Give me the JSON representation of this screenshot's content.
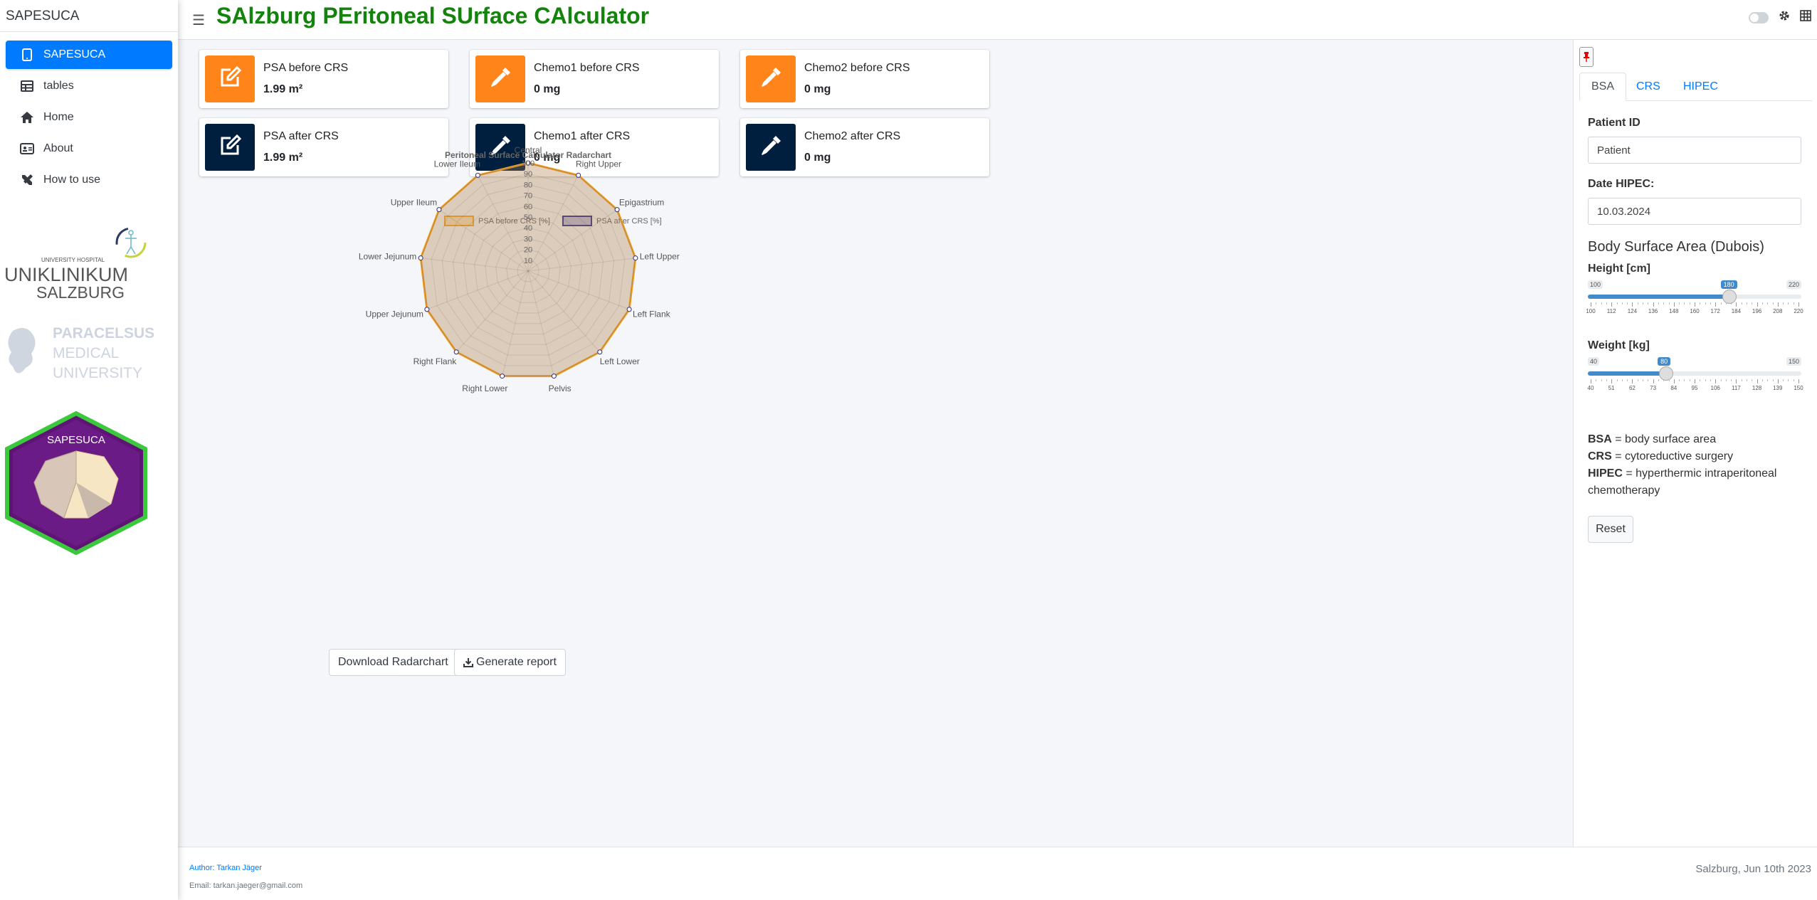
{
  "sidebar": {
    "brand": "SAPESUCA",
    "items": [
      {
        "label": "SAPESUCA",
        "icon": "tablet-icon"
      },
      {
        "label": "tables",
        "icon": "table-icon"
      },
      {
        "label": "Home",
        "icon": "home-icon"
      },
      {
        "label": "About",
        "icon": "id-card-icon"
      },
      {
        "label": "How to use",
        "icon": "tools-icon"
      }
    ],
    "logo_uk": {
      "small": "UNIVERSITY HOSPITAL",
      "line1": "UNIKLINIKUM",
      "line2": "SALZBURG"
    },
    "logo_pmu": {
      "line1": "PARACELSUS",
      "line2": "MEDICAL",
      "line3": "UNIVERSITY"
    },
    "hex_label": "SAPESUCA"
  },
  "header": {
    "title": "SAlzburg PEritoneal SUrface CAlculator",
    "title_color": "#14830d"
  },
  "infoboxes": [
    {
      "label": "PSA before CRS",
      "value": "1.99 m²",
      "icon": "edit-icon",
      "color": "#ff851b"
    },
    {
      "label": "Chemo1 before CRS",
      "value": "0 mg",
      "icon": "eyedropper-icon",
      "color": "#ff851b"
    },
    {
      "label": "Chemo2 before CRS",
      "value": "0 mg",
      "icon": "eyedropper-icon",
      "color": "#ff851b"
    },
    {
      "label": "PSA after CRS",
      "value": "1.99 m²",
      "icon": "edit-icon",
      "color": "#001f3f"
    },
    {
      "label": "Chemo1 after CRS",
      "value": "0 mg",
      "icon": "eyedropper-icon",
      "color": "#001f3f"
    },
    {
      "label": "Chemo2 after CRS",
      "value": "0 mg",
      "icon": "eyedropper-icon",
      "color": "#001f3f"
    }
  ],
  "chart_data": {
    "type": "radar",
    "title": "Peritoneal Surface Calculator Radarchart",
    "categories": [
      "Central",
      "Right Upper",
      "Epigastrium",
      "Left Upper",
      "Left Flank",
      "Left Lower",
      "Pelvis",
      "Right Lower",
      "Right Flank",
      "Upper Jejunum",
      "Lower Jejunum",
      "Upper Ileum",
      "Lower Ileum"
    ],
    "series": [
      {
        "name": "PSA before CRS [%]",
        "values": [
          100,
          100,
          100,
          100,
          100,
          100,
          100,
          100,
          100,
          100,
          100,
          100,
          100
        ],
        "color": "#f5a623"
      },
      {
        "name": "PSA after CRS [%]",
        "values": [
          100,
          100,
          100,
          100,
          100,
          100,
          100,
          100,
          100,
          100,
          100,
          100,
          100
        ],
        "color": "#2f2f8f"
      }
    ],
    "rlim": [
      0,
      100
    ],
    "ticks": [
      "10",
      "20",
      "30",
      "40",
      "50",
      "60",
      "70",
      "80",
      "90",
      "100"
    ],
    "legend_position": "top"
  },
  "buttons": {
    "download": "Download Radarchart",
    "report": "Generate report"
  },
  "controlbar": {
    "tabs": [
      "BSA",
      "CRS",
      "HIPEC"
    ],
    "patient_id_label": "Patient ID",
    "patient_id_value": "Patient",
    "date_label": "Date HIPEC:",
    "date_value": "10.03.2024",
    "section_title": "Body Surface Area (Dubois)",
    "height": {
      "label": "Height [cm]",
      "min": 100,
      "max": 220,
      "value": 180,
      "min_label": "100",
      "max_label": "220",
      "value_label": "180",
      "ticks": [
        "100",
        "112",
        "124",
        "136",
        "148",
        "160",
        "172",
        "184",
        "196",
        "208",
        "220"
      ]
    },
    "weight": {
      "label": "Weight [kg]",
      "min": 40,
      "max": 150,
      "value": 80,
      "min_label": "40",
      "max_label": "150",
      "value_label": "80",
      "ticks": [
        "40",
        "51",
        "62",
        "73",
        "84",
        "95",
        "106",
        "117",
        "128",
        "139",
        "150"
      ]
    },
    "abbrev": [
      {
        "key": "BSA",
        "text": "= body surface area"
      },
      {
        "key": "CRS",
        "text": "= cytoreductive surgery"
      },
      {
        "key": "HIPEC",
        "text": "= hyperthermic intraperitoneal chemotherapy"
      }
    ],
    "reset_label": "Reset"
  },
  "footer": {
    "author": "Author: Tarkan Jäger",
    "email": "Email: tarkan.jaeger@gmail.com",
    "right": "Salzburg, Jun 10th 2023"
  }
}
